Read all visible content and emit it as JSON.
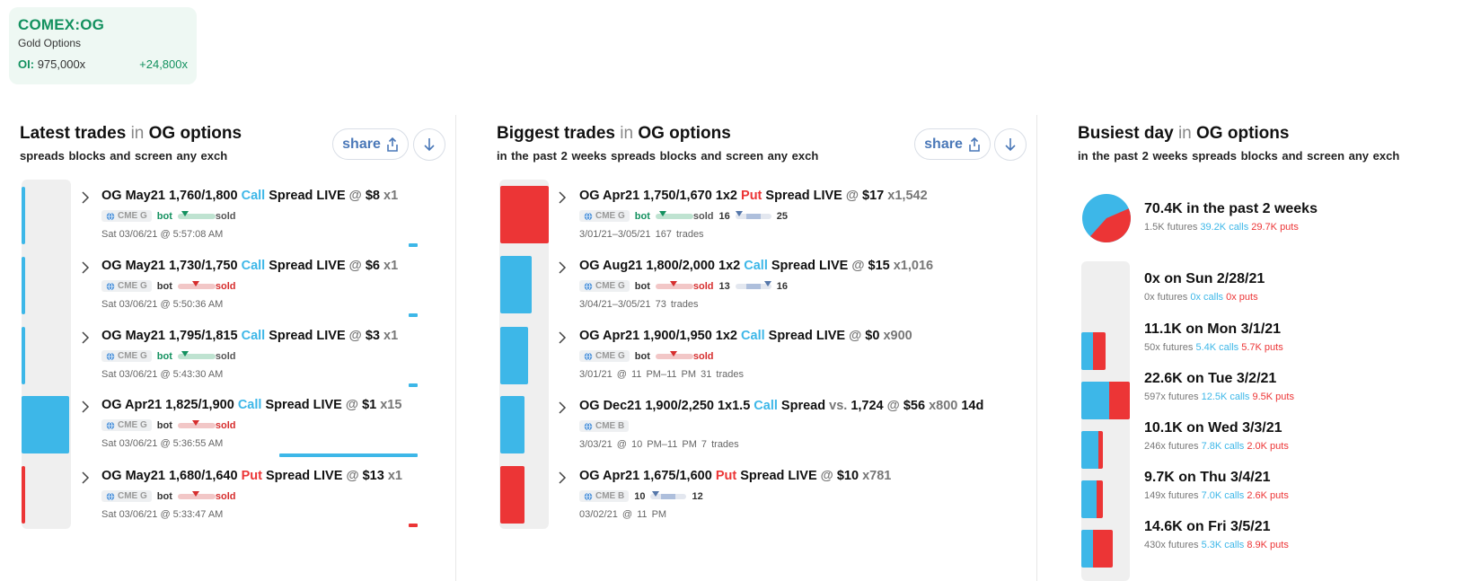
{
  "ticker": {
    "symbol": "COMEX:OG",
    "name": "Gold Options",
    "oi_label": "OI:",
    "oi_value": "975,000x",
    "oi_change": "+24,800x"
  },
  "colors": {
    "call": "#3db7e8",
    "put": "#ec3536",
    "green": "#13915f",
    "link": "#4a78b8"
  },
  "panels": {
    "latest": {
      "title": "Latest trades",
      "in": "in",
      "subject": "OG options",
      "subtitle": "spreads blocks and screen any exch",
      "share_label": "share",
      "trades": [
        {
          "pre": "OG May21 1,760/1,800",
          "kind": "Call",
          "post": "Spread LIVE",
          "at": "@",
          "price": "$8",
          "qty": "x1",
          "exch": "CME G",
          "bot": "bot",
          "sold": "sold",
          "ts": "Sat 03/06/21 @ 5:57:08 AM",
          "side": "bot"
        },
        {
          "pre": "OG May21 1,730/1,750",
          "kind": "Call",
          "post": "Spread LIVE",
          "at": "@",
          "price": "$6",
          "qty": "x1",
          "exch": "CME G",
          "bot": "bot",
          "sold": "sold",
          "ts": "Sat 03/06/21 @ 5:50:36 AM",
          "side": "sold"
        },
        {
          "pre": "OG May21 1,795/1,815",
          "kind": "Call",
          "post": "Spread LIVE",
          "at": "@",
          "price": "$3",
          "qty": "x1",
          "exch": "CME G",
          "bot": "bot",
          "sold": "sold",
          "ts": "Sat 03/06/21 @ 5:43:30 AM",
          "side": "bot"
        },
        {
          "pre": "OG Apr21 1,825/1,900",
          "kind": "Call",
          "post": "Spread LIVE",
          "at": "@",
          "price": "$1",
          "qty": "x15",
          "exch": "CME G",
          "bot": "bot",
          "sold": "sold",
          "ts": "Sat 03/06/21 @ 5:36:55 AM",
          "side": "sold"
        },
        {
          "pre": "OG May21 1,680/1,640",
          "kind": "Put",
          "post": "Spread LIVE",
          "at": "@",
          "price": "$13",
          "qty": "x1",
          "exch": "CME G",
          "bot": "bot",
          "sold": "sold",
          "ts": "Sat 03/06/21 @ 5:33:47 AM",
          "side": "sold"
        }
      ]
    },
    "biggest": {
      "title": "Biggest trades",
      "in": "in",
      "subject": "OG options",
      "subtitle": "in the past 2 weeks spreads blocks and screen any exch",
      "share_label": "share",
      "trades": [
        {
          "pre": "OG Apr21 1,750/1,670 1x2",
          "kind": "Put",
          "post": "Spread LIVE",
          "at": "@",
          "price": "$17",
          "qty": "x1,542",
          "exch": "CME G",
          "bot": "bot",
          "sold": "sold",
          "n1": "16",
          "n2": "25",
          "ts": "3/01/21–3/05/21  167 trades"
        },
        {
          "pre": "OG Aug21 1,800/2,000 1x2",
          "kind": "Call",
          "post": "Spread LIVE",
          "at": "@",
          "price": "$15",
          "qty": "x1,016",
          "exch": "CME G",
          "bot": "bot",
          "sold": "sold",
          "n1": "13",
          "n2": "16",
          "ts": "3/04/21–3/05/21  73 trades"
        },
        {
          "pre": "OG Apr21 1,900/1,950 1x2",
          "kind": "Call",
          "post": "Spread LIVE",
          "at": "@",
          "price": "$0",
          "qty": "x900",
          "exch": "CME G",
          "bot": "bot",
          "sold": "sold",
          "ts": "3/01/21 @ 11 PM–11 PM  31 trades"
        },
        {
          "pre": "OG Dec21 1,900/2,250 1x1.5",
          "kind": "Call",
          "post": "Spread",
          "vs": "vs.",
          "vsval": "1,724",
          "at": "@",
          "price": "$56",
          "qty": "x800",
          "tail": "14d",
          "exch": "CME B",
          "ts": "3/03/21 @ 10 PM–11 PM  7 trades"
        },
        {
          "pre": "OG Apr21 1,675/1,600",
          "kind": "Put",
          "post": "Spread LIVE",
          "at": "@",
          "price": "$10",
          "qty": "x781",
          "exch": "CME B",
          "n1": "10",
          "n2": "12",
          "ts": "03/02/21 @ 11 PM"
        }
      ]
    },
    "busiest": {
      "title": "Busiest day",
      "in": "in",
      "subject": "OG options",
      "subtitle": "in the past 2 weeks spreads blocks and screen any exch",
      "summary": {
        "title": "70.4K in the past 2 weeks",
        "futures": "1.5K futures",
        "calls": "39.2K calls",
        "puts": "29.7K puts",
        "calls_share": 0.569,
        "puts_share": 0.431
      },
      "days": [
        {
          "title": "0x on Sun 2/28/21",
          "futures": "0x futures",
          "calls": "0x calls",
          "puts": "0x puts",
          "calls_k": 0,
          "puts_k": 0
        },
        {
          "title": "11.1K on Mon 3/1/21",
          "futures": "50x futures",
          "calls": "5.4K calls",
          "puts": "5.7K puts",
          "calls_k": 5.4,
          "puts_k": 5.7
        },
        {
          "title": "22.6K on Tue 3/2/21",
          "futures": "597x futures",
          "calls": "12.5K calls",
          "puts": "9.5K puts",
          "calls_k": 12.5,
          "puts_k": 9.5
        },
        {
          "title": "10.1K on Wed 3/3/21",
          "futures": "246x futures",
          "calls": "7.8K calls",
          "puts": "2.0K puts",
          "calls_k": 7.8,
          "puts_k": 2.0
        },
        {
          "title": "9.7K on Thu 3/4/21",
          "futures": "149x futures",
          "calls": "7.0K calls",
          "puts": "2.6K puts",
          "calls_k": 7.0,
          "puts_k": 2.6
        },
        {
          "title": "14.6K on Fri 3/5/21",
          "futures": "430x futures",
          "calls": "5.3K calls",
          "puts": "8.9K puts",
          "calls_k": 5.3,
          "puts_k": 8.9
        }
      ]
    }
  }
}
